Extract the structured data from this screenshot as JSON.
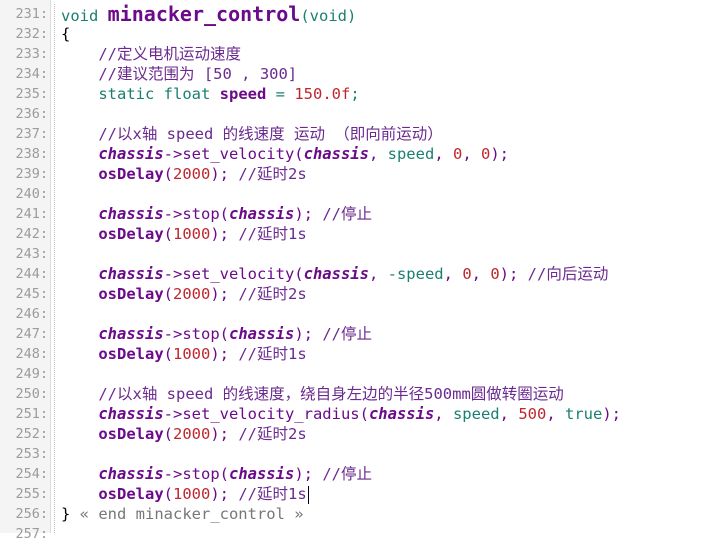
{
  "editor": {
    "lines": [
      {
        "n": "231:",
        "segs": [
          [
            "kw",
            "void "
          ],
          [
            "fn big",
            "minacker_control"
          ],
          [
            "kw",
            "(void)"
          ]
        ]
      },
      {
        "n": "232:",
        "segs": [
          [
            "plain",
            "{"
          ]
        ]
      },
      {
        "n": "233:",
        "segs": [
          [
            "plain",
            "    "
          ],
          [
            "cm",
            "//定义电机运动速度"
          ]
        ]
      },
      {
        "n": "234:",
        "segs": [
          [
            "plain",
            "    "
          ],
          [
            "cm",
            "//建议范围为 [50 , 300]"
          ]
        ]
      },
      {
        "n": "235:",
        "segs": [
          [
            "plain",
            "    "
          ],
          [
            "kw",
            "static float "
          ],
          [
            "fn",
            "speed"
          ],
          [
            "kw",
            " = "
          ],
          [
            "num",
            "150.0f"
          ],
          [
            "kw",
            ";"
          ]
        ]
      },
      {
        "n": "236:",
        "segs": []
      },
      {
        "n": "237:",
        "segs": [
          [
            "plain",
            "    "
          ],
          [
            "cm",
            "//以x轴 speed 的线速度 运动 （即向前运动）"
          ]
        ]
      },
      {
        "n": "238:",
        "segs": [
          [
            "plain",
            "    "
          ],
          [
            "ptr",
            "chassis"
          ],
          [
            "par",
            "->set_velocity("
          ],
          [
            "ptr",
            "chassis"
          ],
          [
            "par",
            ", "
          ],
          [
            "var",
            "speed"
          ],
          [
            "par",
            ", "
          ],
          [
            "num",
            "0"
          ],
          [
            "par",
            ", "
          ],
          [
            "num",
            "0"
          ],
          [
            "par",
            ");"
          ]
        ]
      },
      {
        "n": "239:",
        "segs": [
          [
            "plain",
            "    "
          ],
          [
            "fn",
            "osDelay"
          ],
          [
            "par",
            "("
          ],
          [
            "num",
            "2000"
          ],
          [
            "par",
            "); "
          ],
          [
            "cm",
            "//延时2s"
          ]
        ]
      },
      {
        "n": "240:",
        "segs": []
      },
      {
        "n": "241:",
        "segs": [
          [
            "plain",
            "    "
          ],
          [
            "ptr",
            "chassis"
          ],
          [
            "par",
            "->stop("
          ],
          [
            "ptr",
            "chassis"
          ],
          [
            "par",
            "); "
          ],
          [
            "cm",
            "//停止"
          ]
        ]
      },
      {
        "n": "242:",
        "segs": [
          [
            "plain",
            "    "
          ],
          [
            "fn",
            "osDelay"
          ],
          [
            "par",
            "("
          ],
          [
            "num",
            "1000"
          ],
          [
            "par",
            "); "
          ],
          [
            "cm",
            "//延时1s"
          ]
        ]
      },
      {
        "n": "243:",
        "segs": []
      },
      {
        "n": "244:",
        "segs": [
          [
            "plain",
            "    "
          ],
          [
            "ptr",
            "chassis"
          ],
          [
            "par",
            "->set_velocity("
          ],
          [
            "ptr",
            "chassis"
          ],
          [
            "par",
            ", "
          ],
          [
            "var",
            "-speed"
          ],
          [
            "par",
            ", "
          ],
          [
            "num",
            "0"
          ],
          [
            "par",
            ", "
          ],
          [
            "num",
            "0"
          ],
          [
            "par",
            "); "
          ],
          [
            "cm",
            "//向后运动"
          ]
        ]
      },
      {
        "n": "245:",
        "segs": [
          [
            "plain",
            "    "
          ],
          [
            "fn",
            "osDelay"
          ],
          [
            "par",
            "("
          ],
          [
            "num",
            "2000"
          ],
          [
            "par",
            "); "
          ],
          [
            "cm",
            "//延时2s"
          ]
        ]
      },
      {
        "n": "246:",
        "segs": []
      },
      {
        "n": "247:",
        "segs": [
          [
            "plain",
            "    "
          ],
          [
            "ptr",
            "chassis"
          ],
          [
            "par",
            "->stop("
          ],
          [
            "ptr",
            "chassis"
          ],
          [
            "par",
            "); "
          ],
          [
            "cm",
            "//停止"
          ]
        ]
      },
      {
        "n": "248:",
        "segs": [
          [
            "plain",
            "    "
          ],
          [
            "fn",
            "osDelay"
          ],
          [
            "par",
            "("
          ],
          [
            "num",
            "1000"
          ],
          [
            "par",
            "); "
          ],
          [
            "cm",
            "//延时1s"
          ]
        ]
      },
      {
        "n": "249:",
        "segs": []
      },
      {
        "n": "250:",
        "segs": [
          [
            "plain",
            "    "
          ],
          [
            "cm",
            "//以x轴 speed 的线速度，绕自身左边的半径500mm圆做转圈运动"
          ]
        ]
      },
      {
        "n": "251:",
        "segs": [
          [
            "plain",
            "    "
          ],
          [
            "ptr",
            "chassis"
          ],
          [
            "par",
            "->set_velocity_radius("
          ],
          [
            "ptr",
            "chassis"
          ],
          [
            "par",
            ", "
          ],
          [
            "var",
            "speed"
          ],
          [
            "par",
            ", "
          ],
          [
            "num",
            "500"
          ],
          [
            "par",
            ", "
          ],
          [
            "kw",
            "true"
          ],
          [
            "par",
            ");"
          ]
        ]
      },
      {
        "n": "252:",
        "segs": [
          [
            "plain",
            "    "
          ],
          [
            "fn",
            "osDelay"
          ],
          [
            "par",
            "("
          ],
          [
            "num",
            "2000"
          ],
          [
            "par",
            "); "
          ],
          [
            "cm",
            "//延时2s"
          ]
        ]
      },
      {
        "n": "253:",
        "segs": []
      },
      {
        "n": "254:",
        "segs": [
          [
            "plain",
            "    "
          ],
          [
            "ptr",
            "chassis"
          ],
          [
            "par",
            "->stop("
          ],
          [
            "ptr",
            "chassis"
          ],
          [
            "par",
            "); "
          ],
          [
            "cm",
            "//停止"
          ]
        ]
      },
      {
        "n": "255:",
        "segs": [
          [
            "plain",
            "    "
          ],
          [
            "fn",
            "osDelay"
          ],
          [
            "par",
            "("
          ],
          [
            "num",
            "1000"
          ],
          [
            "par",
            "); "
          ],
          [
            "cm",
            "//延时1s"
          ]
        ],
        "cursor": true
      },
      {
        "n": "256:",
        "segs": [
          [
            "plain",
            "} "
          ],
          [
            "fold",
            "« end minacker_control »"
          ]
        ]
      },
      {
        "n": "257:",
        "segs": []
      }
    ]
  }
}
